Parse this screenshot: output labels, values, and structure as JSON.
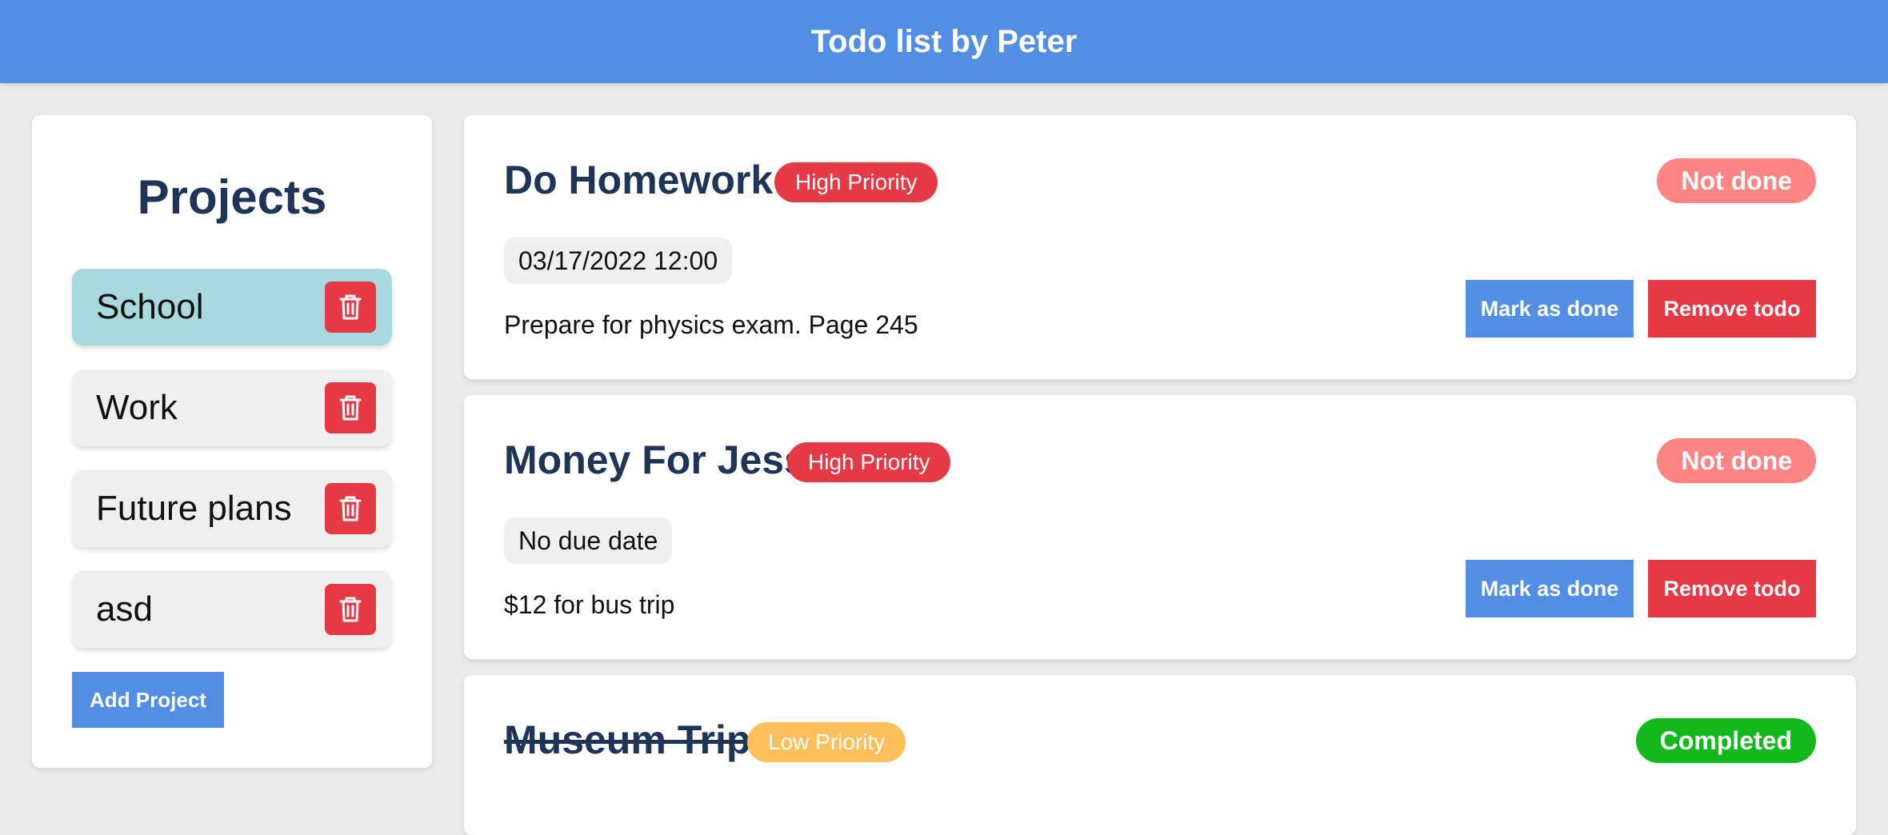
{
  "header": {
    "title": "Todo list by Peter"
  },
  "sidebar": {
    "heading": "Projects",
    "projects": [
      {
        "label": "School",
        "active": true
      },
      {
        "label": "Work",
        "active": false
      },
      {
        "label": "Future plans",
        "active": false
      },
      {
        "label": "asd",
        "active": false
      }
    ],
    "add_label": "Add Project",
    "delete_icon": "trash-icon"
  },
  "todos": [
    {
      "title": "Do Homework",
      "priority": "High Priority",
      "status": "Not done",
      "due": "03/17/2022 12:00",
      "description": "Prepare for physics exam. Page 245",
      "mark_label": "Mark as done",
      "remove_label": "Remove todo"
    },
    {
      "title": "Money For Jess",
      "priority": "High Priority",
      "status": "Not done",
      "due": "No due date",
      "description": "$12 for bus trip",
      "mark_label": "Mark as done",
      "remove_label": "Remove todo"
    },
    {
      "title": "Museum Trip",
      "priority": "Low Priority",
      "status": "Completed"
    }
  ],
  "colors": {
    "header": "#528ee4",
    "danger": "#e63946",
    "active_project": "#a8d9dc",
    "not_done": "#ff8585",
    "completed": "#12b81c",
    "low_priority": "#ffbf5a"
  }
}
